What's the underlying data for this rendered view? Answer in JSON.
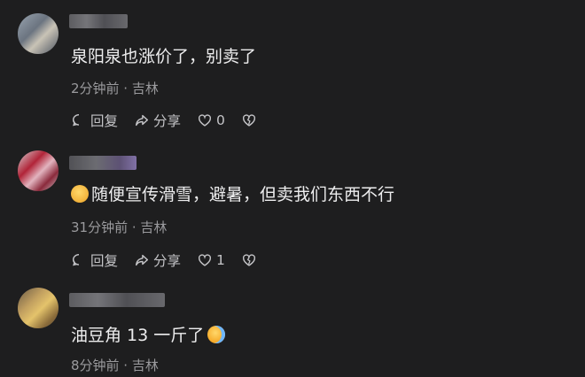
{
  "comments": [
    {
      "text": "泉阳泉也涨价了，别卖了",
      "meta": "2分钟前 · 吉林",
      "reply": "回复",
      "share": "分享",
      "likes": "0"
    },
    {
      "emoji": "thinking-face-icon",
      "text": "随便宣传滑雪，避暑，但卖我们东西不行",
      "meta": "31分钟前 · 吉林",
      "reply": "回复",
      "share": "分享",
      "likes": "1"
    },
    {
      "text": "油豆角 13 一斤了",
      "emoji": "crying-laughing-face-icon",
      "meta": "8分钟前 · 吉林"
    }
  ]
}
